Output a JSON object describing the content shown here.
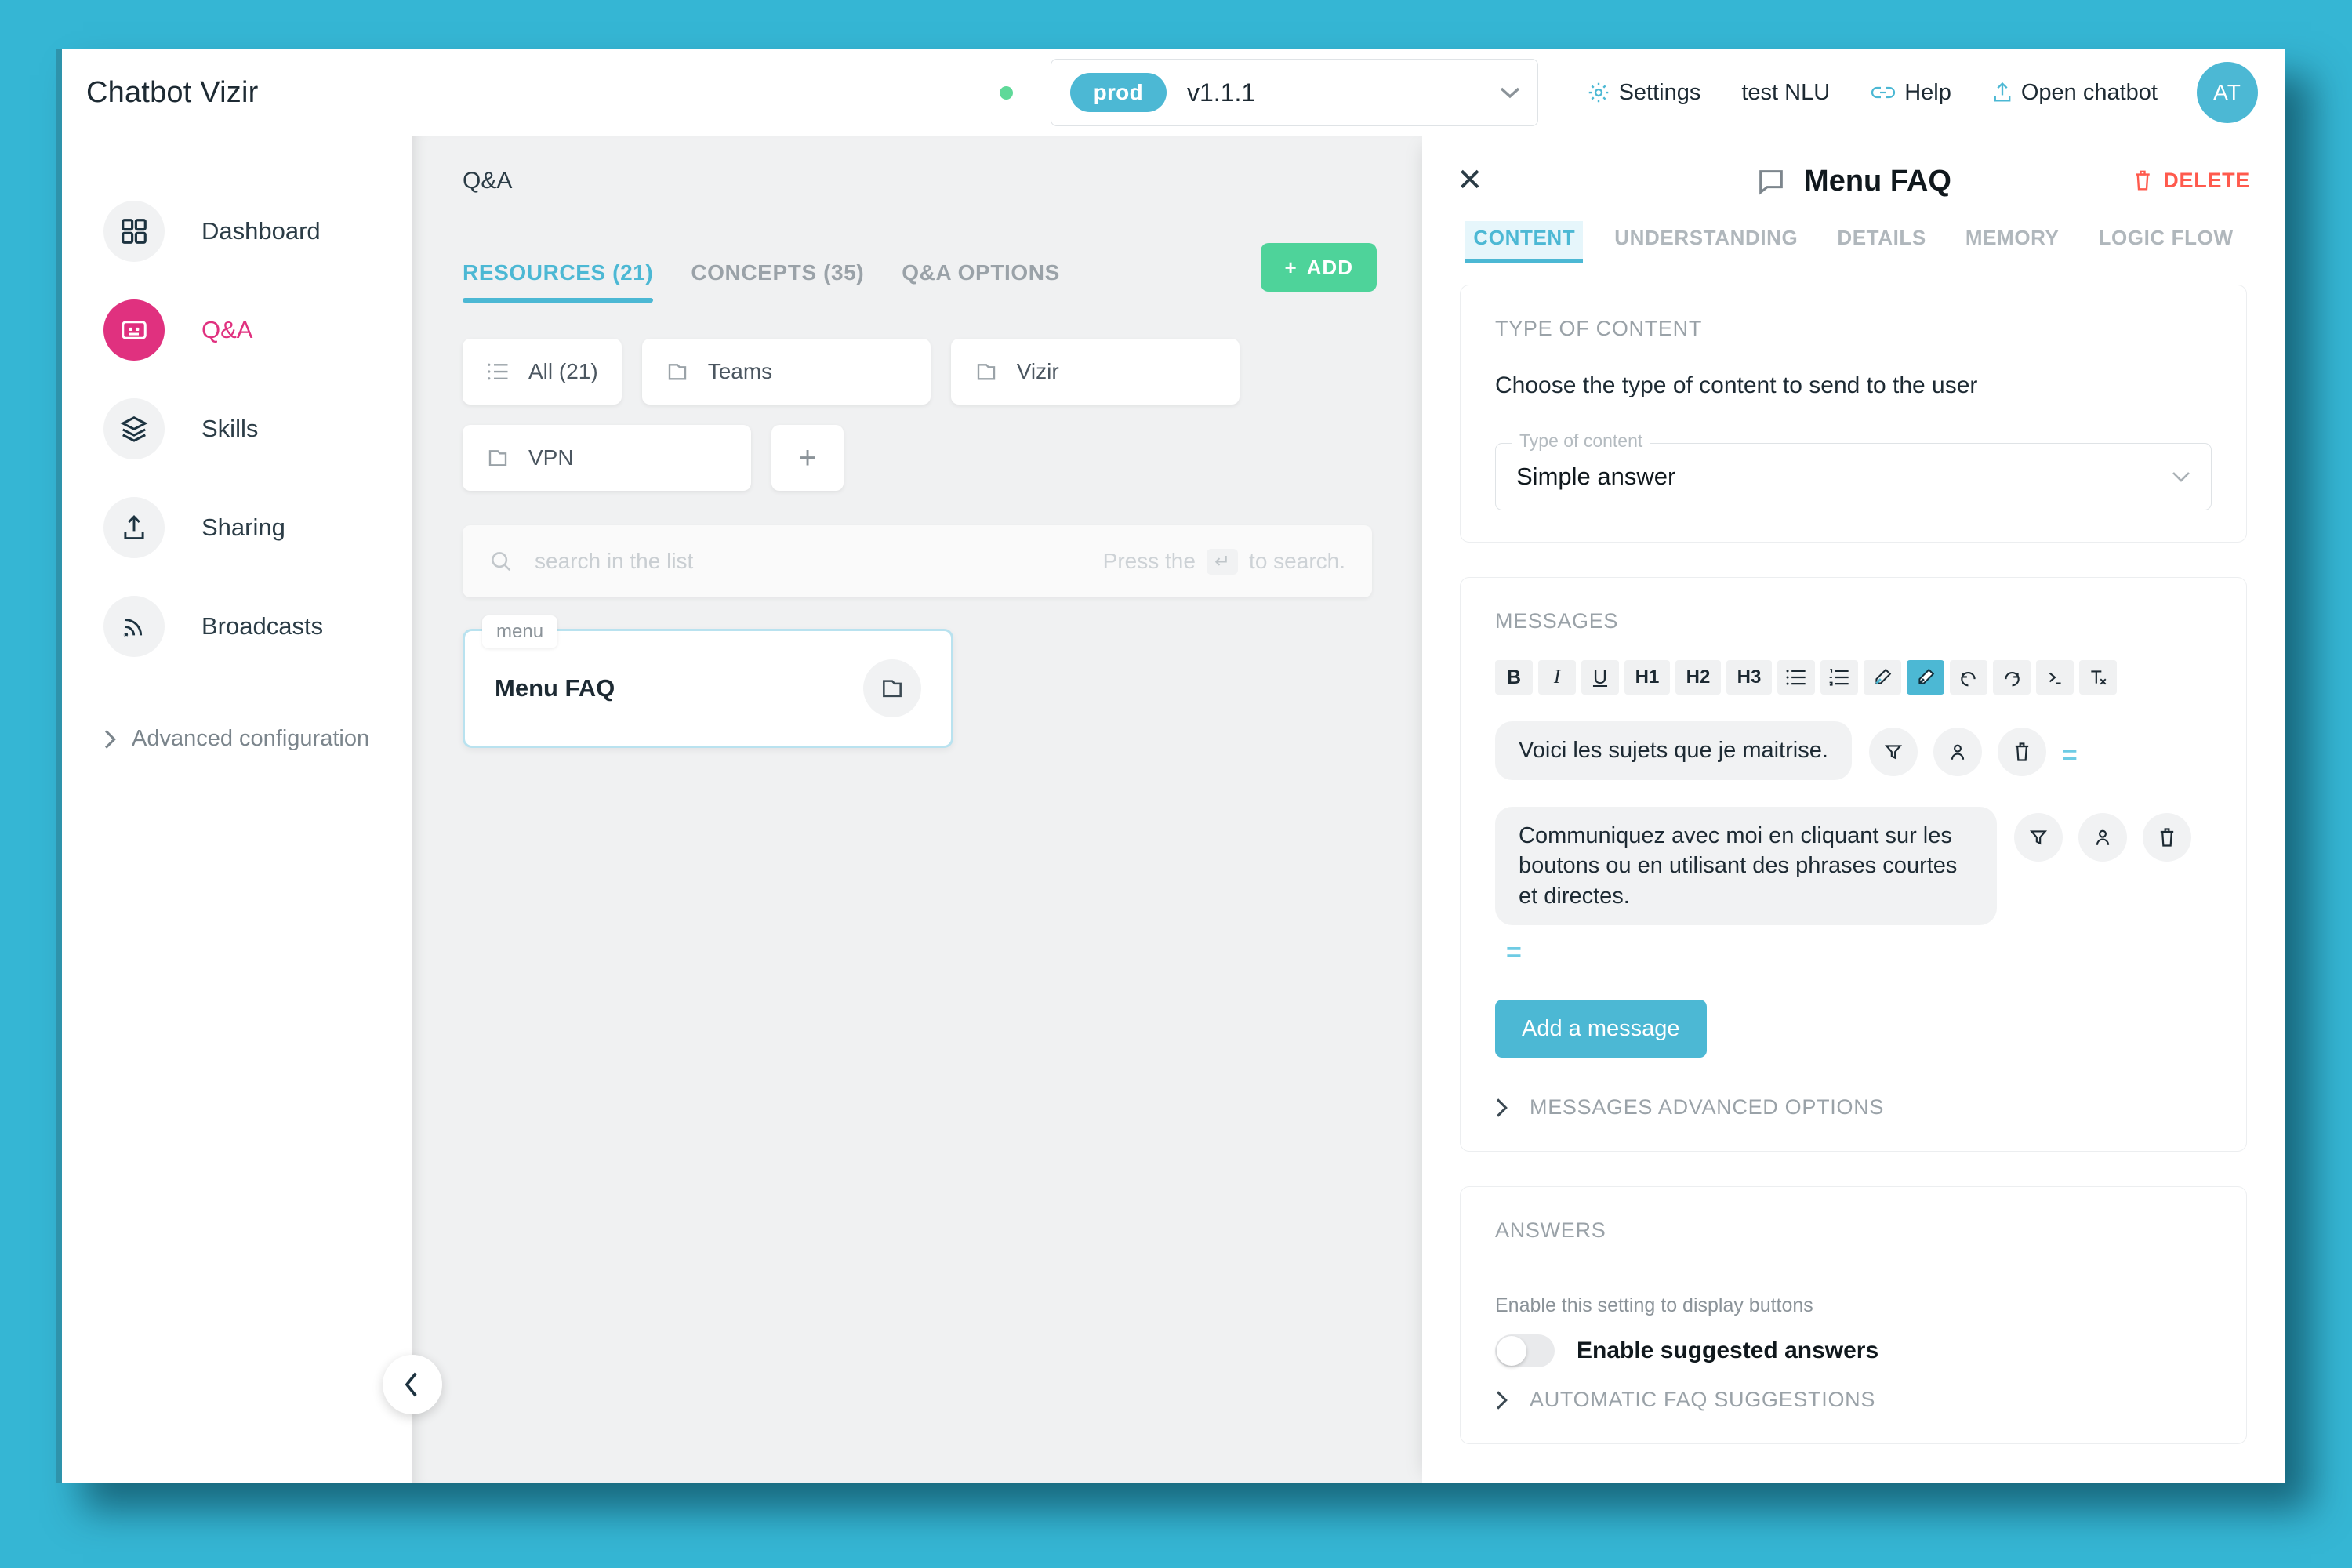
{
  "header": {
    "app_title": "Chatbot Vizir",
    "status_dot_color": "#5fd999",
    "env_badge": "prod",
    "version": "v1.1.1",
    "actions": [
      {
        "label": "Settings",
        "icon": "gear-icon"
      },
      {
        "label": "test NLU",
        "icon": "none"
      },
      {
        "label": "Help",
        "icon": "link-icon"
      },
      {
        "label": "Open chatbot",
        "icon": "upload-icon"
      }
    ],
    "avatar_initials": "AT"
  },
  "sidebar": {
    "items": [
      {
        "label": "Dashboard",
        "icon": "grid-icon",
        "active": false
      },
      {
        "label": "Q&A",
        "icon": "robot-icon",
        "active": true
      },
      {
        "label": "Skills",
        "icon": "layers-icon",
        "active": false
      },
      {
        "label": "Sharing",
        "icon": "share-upload-icon",
        "active": false
      },
      {
        "label": "Broadcasts",
        "icon": "rss-icon",
        "active": false
      }
    ],
    "advanced_configuration": "Advanced configuration"
  },
  "list_panel": {
    "breadcrumb": "Q&A",
    "tabs": [
      {
        "label": "RESOURCES (21)",
        "active": true
      },
      {
        "label": "CONCEPTS (35)",
        "active": false
      },
      {
        "label": "Q&A OPTIONS",
        "active": false
      }
    ],
    "add_button": "ADD",
    "chips": [
      {
        "label": "All (21)",
        "icon": "list-icon"
      },
      {
        "label": "Teams",
        "icon": "folder-icon"
      },
      {
        "label": "Vizir",
        "icon": "folder-icon"
      },
      {
        "label": "VPN",
        "icon": "folder-icon"
      },
      {
        "label": "+",
        "icon": "plus-icon"
      }
    ],
    "search": {
      "placeholder": "search in the list",
      "hint_before": "Press the",
      "hint_key": "↵",
      "hint_after": "to search."
    },
    "items": [
      {
        "tag": "menu",
        "title": "Menu FAQ",
        "folder_icon": "folder-icon",
        "selected": true
      }
    ],
    "collapse_icon": "chevron-left-icon"
  },
  "detail_panel": {
    "close_icon": "close-icon",
    "title": "Menu FAQ",
    "title_icon": "chat-bubble-icon",
    "delete_label": "DELETE",
    "delete_color": "#ff5a4d",
    "tabs": [
      {
        "label": "CONTENT",
        "active": true
      },
      {
        "label": "UNDERSTANDING",
        "active": false
      },
      {
        "label": "DETAILS",
        "active": false
      },
      {
        "label": "MEMORY",
        "active": false
      },
      {
        "label": "LOGIC FLOW",
        "active": false
      }
    ],
    "type_of_content": {
      "section_label": "TYPE OF CONTENT",
      "description": "Choose the type of content to send to the user",
      "field_legend": "Type of content",
      "value": "Simple answer"
    },
    "messages": {
      "section_label": "MESSAGES",
      "toolbar": [
        {
          "name": "bold-icon",
          "glyph": "B",
          "style": "bold",
          "highlighted": false
        },
        {
          "name": "italic-icon",
          "glyph": "I",
          "style": "italic",
          "highlighted": false
        },
        {
          "name": "underline-icon",
          "glyph": "U",
          "style": "underline",
          "highlighted": false
        },
        {
          "name": "heading-1-icon",
          "glyph": "H1",
          "style": "wide",
          "highlighted": false
        },
        {
          "name": "heading-2-icon",
          "glyph": "H2",
          "style": "wide",
          "highlighted": false
        },
        {
          "name": "heading-3-icon",
          "glyph": "H3",
          "style": "wide",
          "highlighted": false
        },
        {
          "name": "bulleted-list-icon",
          "glyph": "☰",
          "style": "",
          "highlighted": false
        },
        {
          "name": "numbered-list-icon",
          "glyph": "≡",
          "style": "",
          "highlighted": false
        },
        {
          "name": "pen-icon",
          "glyph": "✐",
          "style": "",
          "highlighted": false
        },
        {
          "name": "highlight-pen-icon",
          "glyph": "✐",
          "style": "",
          "highlighted": true
        },
        {
          "name": "undo-icon",
          "glyph": "↺",
          "style": "",
          "highlighted": false
        },
        {
          "name": "redo-icon",
          "glyph": "↻",
          "style": "",
          "highlighted": false
        },
        {
          "name": "code-icon",
          "glyph": "❯_",
          "style": "",
          "highlighted": false
        },
        {
          "name": "clear-format-icon",
          "glyph": "Tₓ",
          "style": "",
          "highlighted": false
        }
      ],
      "items": [
        {
          "text": "Voici les sujets que je maitrise.",
          "actions": [
            "filter-icon",
            "user-icon",
            "trash-icon"
          ],
          "drag_handle": "="
        },
        {
          "text": "Communiquez avec moi en cliquant sur les boutons ou en utilisant des phrases courtes et directes.",
          "actions": [
            "filter-icon",
            "user-icon",
            "trash-icon"
          ],
          "drag_handle": "="
        }
      ],
      "add_message_label": "Add a message",
      "advanced_options_label": "MESSAGES ADVANCED OPTIONS"
    },
    "answers": {
      "section_label": "ANSWERS",
      "hint": "Enable this setting to display buttons",
      "toggle_label": "Enable suggested answers",
      "toggle_on": false,
      "faq_suggestions_label": "AUTOMATIC FAQ SUGGESTIONS"
    }
  },
  "theme": {
    "accent_teal": "#4cb8d4",
    "accent_pink": "#e0317f",
    "accent_green": "#4ed39a",
    "desktop_bg": "#35b6d4"
  }
}
